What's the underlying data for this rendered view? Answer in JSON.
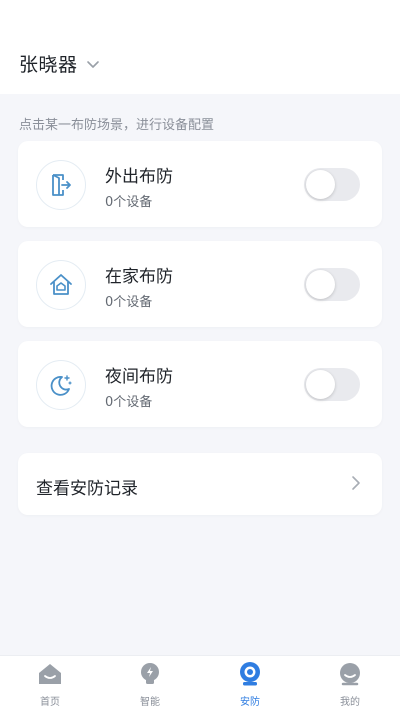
{
  "header": {
    "home_name": "张晓器",
    "dropdown_icon": "chevron-down-icon"
  },
  "hint": "点击某一布防场景，进行设备配置",
  "scenes": [
    {
      "title": "外出布防",
      "subtitle": "0个设备",
      "icon": "exit-door-icon",
      "enabled": false
    },
    {
      "title": "在家布防",
      "subtitle": "0个设备",
      "icon": "home-icon",
      "enabled": false
    },
    {
      "title": "夜间布防",
      "subtitle": "0个设备",
      "icon": "moon-icon",
      "enabled": false
    }
  ],
  "record": {
    "label": "查看安防记录",
    "icon": "chevron-right-icon"
  },
  "tabs": [
    {
      "label": "首页",
      "icon": "home-icon",
      "active": false
    },
    {
      "label": "智能",
      "icon": "lightbulb-icon",
      "active": false
    },
    {
      "label": "安防",
      "icon": "camera-icon",
      "active": true
    },
    {
      "label": "我的",
      "icon": "profile-icon",
      "active": false
    }
  ],
  "colors": {
    "accent": "#2f7de1",
    "scene_icon": "#4a90c8",
    "background": "#f5f6fa",
    "toggle_off": "#e9eaee",
    "tab_inactive": "#9aa0a8"
  }
}
